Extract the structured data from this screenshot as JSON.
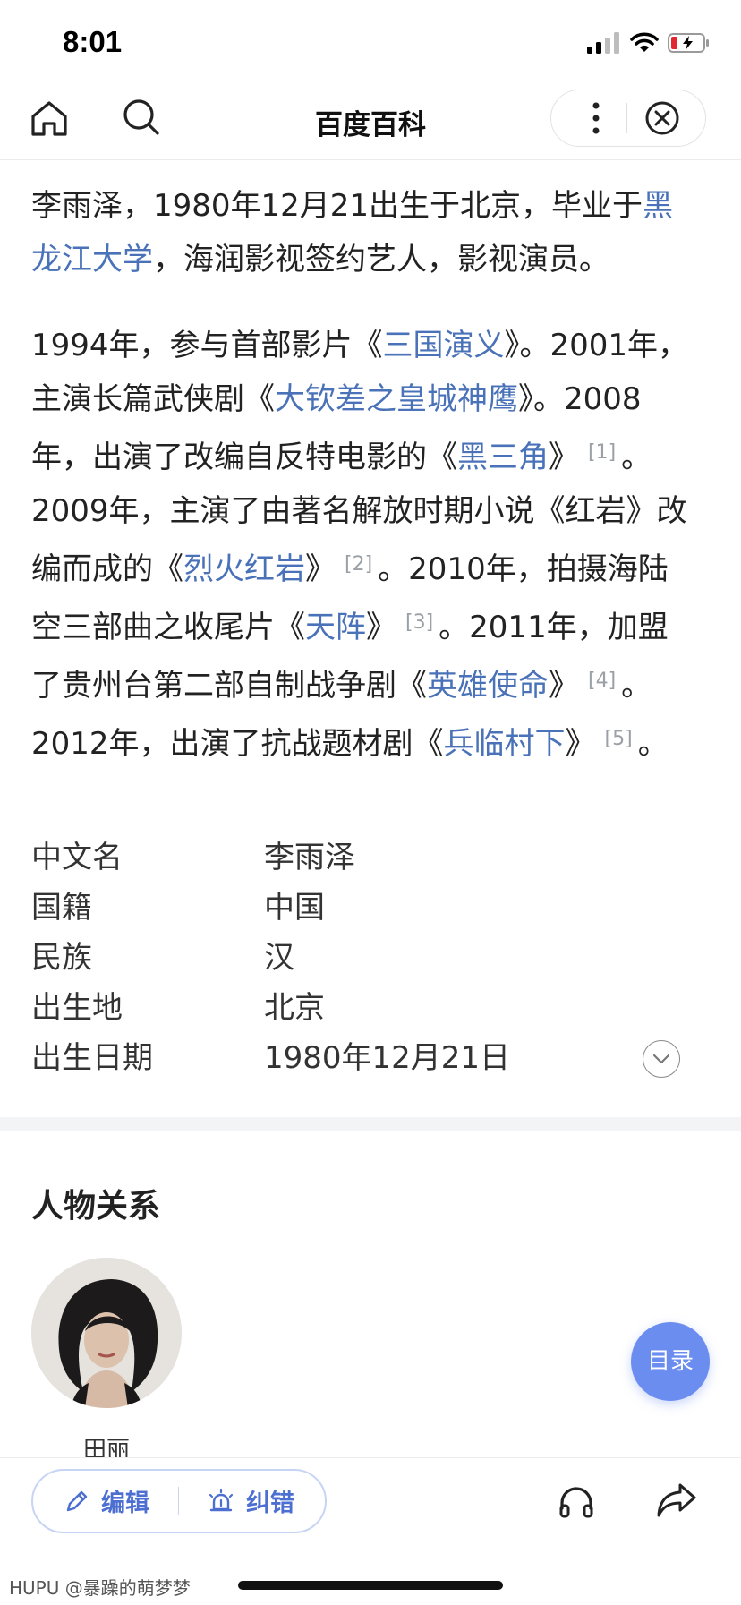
{
  "status_bar": {
    "time": "8:01"
  },
  "nav": {
    "title": "百度百科"
  },
  "intro": {
    "p1": {
      "text1": "李雨泽，1980年12月21出生于北京，毕业于",
      "link1": "黑龙江大学",
      "text2": "，海润影视签约艺人，影视演员。"
    },
    "p2": {
      "t1": "1994年，参与首部影片《",
      "l1": "三国演义",
      "t2": "》。2001年，主演长篇武侠剧《",
      "l2": "大钦差之皇城神鹰",
      "t3": "》。2008年，出演了改编自反特电影的《",
      "l3": "黑三角",
      "t4": "》",
      "r1": "[1]",
      "t5": "。2009年，主演了由著名解放时期小说《红岩》改编而成的《",
      "l4": "烈火红岩",
      "t6": "》",
      "r2": "[2]",
      "t7": "。2010年，拍摄海陆空三部曲之收尾片《",
      "l5": "天阵",
      "t8": "》",
      "r3": "[3]",
      "t9": "。2011年，加盟了贵州台第二部自制战争剧《",
      "l6": "英雄使命",
      "t10": "》",
      "r4": "[4]",
      "t11": "。2012年，出演了抗战题材剧《",
      "l7": "兵临村下",
      "t12": "》",
      "r5": "[5]",
      "t13": "。"
    }
  },
  "infobox": [
    {
      "key": "中文名",
      "value": "李雨泽"
    },
    {
      "key": "国籍",
      "value": "中国"
    },
    {
      "key": "民族",
      "value": "汉"
    },
    {
      "key": "出生地",
      "value": "北京"
    },
    {
      "key": "出生日期",
      "value": "1980年12月21日"
    }
  ],
  "relations": {
    "title": "人物关系",
    "people": [
      {
        "name": "田丽"
      }
    ]
  },
  "toc_button": "目录",
  "bottom": {
    "edit": "编辑",
    "correct": "纠错"
  },
  "watermark": "HUPU @暴躁的萌梦梦",
  "colors": {
    "link": "#4a72b8",
    "accent": "#6b8df0",
    "action": "#4d6fd1"
  }
}
